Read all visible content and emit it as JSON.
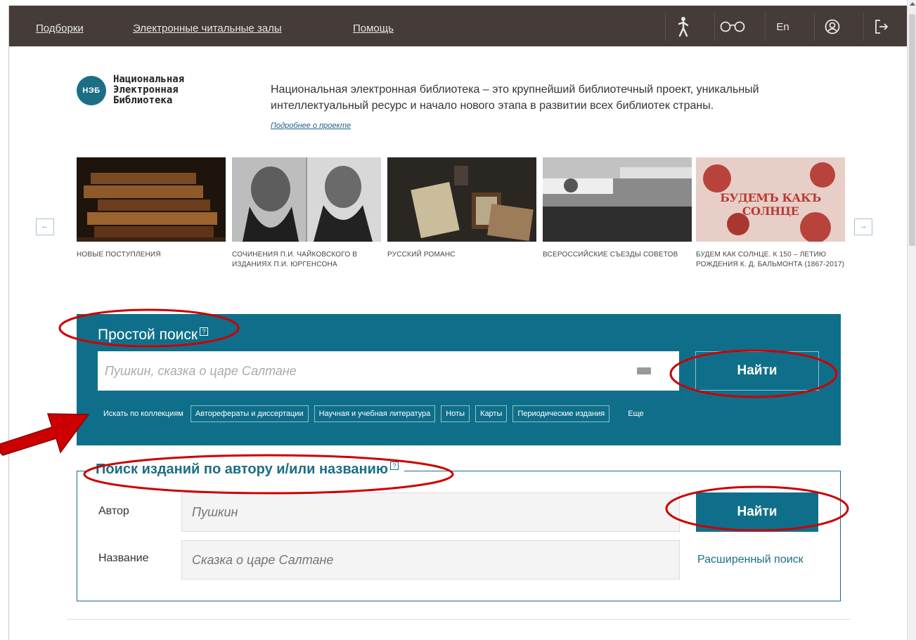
{
  "nav": {
    "links": [
      "Подборки",
      "Электронные читальные залы",
      "Помощь"
    ],
    "lang": "En"
  },
  "logo": {
    "abbr": "НЭБ",
    "line1": "Национальная",
    "line2": "Электронная",
    "line3": "Библиотека"
  },
  "intro": {
    "text": "Национальная электронная библиотека – это крупнейший библиотечный проект, уникальный интеллектуальный ресурс и начало нового этапа в развитии всех библиотек страны.",
    "more": "Подробнее о проекте"
  },
  "carousel": [
    {
      "caption": "Новые поступления",
      "image": "old-books"
    },
    {
      "caption": "Сочинения П.И. Чайковского в изданиях П.И. Юргенсона",
      "image": "two-portraits"
    },
    {
      "caption": "Русский романс",
      "image": "romance-still-life"
    },
    {
      "caption": "Всероссийские съезды Советов",
      "image": "congress-hall"
    },
    {
      "caption": "Будем как солнце. К 150 – летию рождения К. Д. Бальмонта (1867-2017)",
      "image": "book-cover",
      "cover_text": "БУДЕМЪ КАКЪ СОЛНЦЕ"
    }
  ],
  "simple_search": {
    "title": "Простой поиск",
    "placeholder": "Пушкин, сказка о царе Салтане",
    "button": "Найти",
    "collections_label": "Искать по коллекциям",
    "collections": [
      "Авторефераты и диссертации",
      "Научная и учебная литература",
      "Ноты",
      "Карты",
      "Периодические издания"
    ],
    "more": "Еще"
  },
  "author_search": {
    "title": "Поиск изданий по автору и/или названию",
    "author_label": "Автор",
    "author_placeholder": "Пушкин",
    "title_label": "Название",
    "title_placeholder": "Сказка о царе Салтане",
    "button": "Найти",
    "advanced": "Расширенный поиск"
  },
  "colors": {
    "nav_bg": "#453b38",
    "accent": "#0f6f8a",
    "annotation": "#cc0000"
  }
}
